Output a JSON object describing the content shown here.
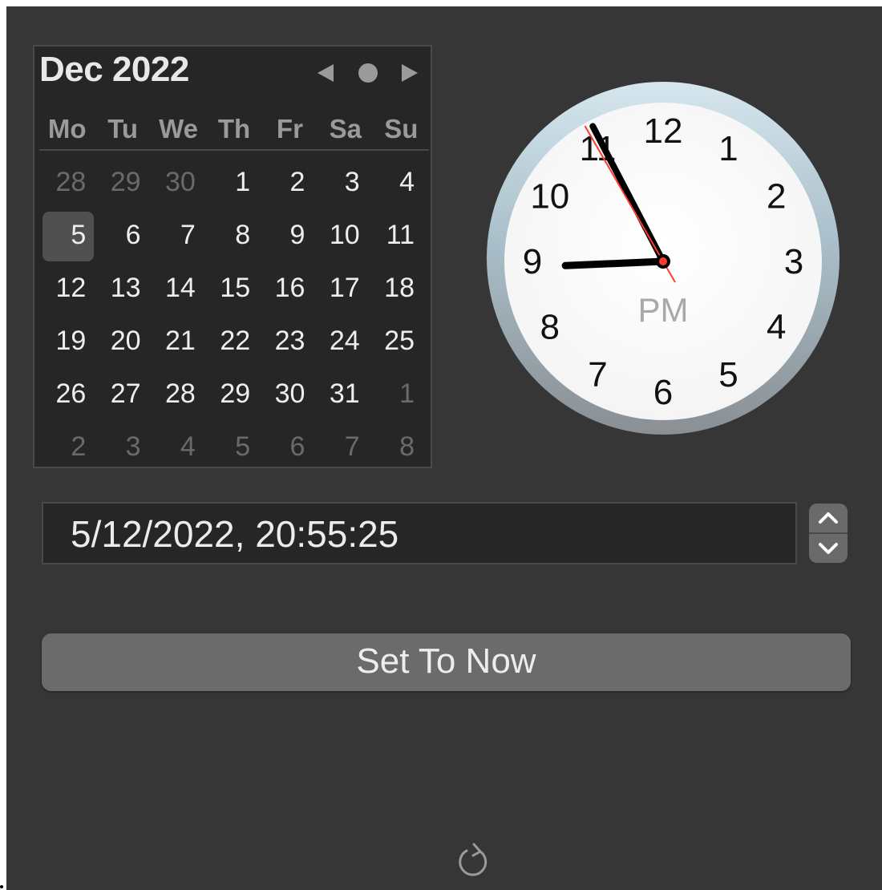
{
  "calendar": {
    "title": "Dec 2022",
    "nav": {
      "prev_icon": "triangle-left-icon",
      "today_icon": "circle-icon",
      "next_icon": "triangle-right-icon"
    },
    "weekdays": [
      "Mo",
      "Tu",
      "We",
      "Th",
      "Fr",
      "Sa",
      "Su"
    ],
    "weeks": [
      [
        "28",
        "29",
        "30",
        "1",
        "2",
        "3",
        "4"
      ],
      [
        "5",
        "6",
        "7",
        "8",
        "9",
        "10",
        "11"
      ],
      [
        "12",
        "13",
        "14",
        "15",
        "16",
        "17",
        "18"
      ],
      [
        "19",
        "20",
        "21",
        "22",
        "23",
        "24",
        "25"
      ],
      [
        "26",
        "27",
        "28",
        "29",
        "30",
        "31",
        "1"
      ],
      [
        "2",
        "3",
        "4",
        "5",
        "6",
        "7",
        "8"
      ]
    ],
    "other_month": [
      [
        true,
        true,
        true,
        false,
        false,
        false,
        false
      ],
      [
        false,
        false,
        false,
        false,
        false,
        false,
        false
      ],
      [
        false,
        false,
        false,
        false,
        false,
        false,
        false
      ],
      [
        false,
        false,
        false,
        false,
        false,
        false,
        false
      ],
      [
        false,
        false,
        false,
        false,
        false,
        false,
        true
      ],
      [
        true,
        true,
        true,
        true,
        true,
        true,
        true
      ]
    ],
    "selected_day": "5"
  },
  "clock": {
    "numerals": [
      "12",
      "1",
      "2",
      "3",
      "4",
      "5",
      "6",
      "7",
      "8",
      "9",
      "10",
      "11"
    ],
    "meridiem": "PM",
    "time": {
      "hour": 20,
      "minute": 55,
      "second": 25
    },
    "colors": {
      "hands": "#000000",
      "second_hand": "#ff3b30",
      "face": "#ffffff",
      "meridiem": "#a8a8a8"
    }
  },
  "datetime_field": {
    "value": "5/12/2022, 20:55:25"
  },
  "stepper": {
    "up_icon": "chevron-up-icon",
    "down_icon": "chevron-down-icon"
  },
  "set_now_button": {
    "label": "Set To Now"
  },
  "refresh_icon": "refresh-icon"
}
